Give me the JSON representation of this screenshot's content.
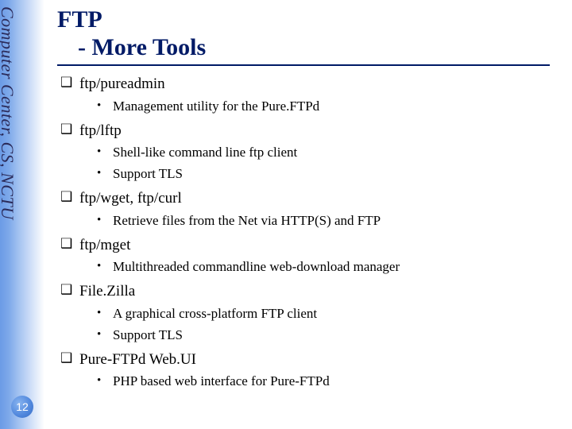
{
  "sidebar": {
    "label": "Computer Center, CS, NCTU"
  },
  "page": {
    "number": "12"
  },
  "title": {
    "line1": "FTP",
    "line2": "- More Tools"
  },
  "items": [
    {
      "label": "ftp/pureadmin",
      "sub": [
        "Management utility for the Pure.FTPd"
      ]
    },
    {
      "label": "ftp/lftp",
      "sub": [
        "Shell-like command line ftp client",
        "Support TLS"
      ]
    },
    {
      "label": "ftp/wget, ftp/curl",
      "sub": [
        "Retrieve files from the Net via HTTP(S) and FTP"
      ]
    },
    {
      "label": "ftp/mget",
      "sub": [
        "Multithreaded commandline web-download manager"
      ]
    },
    {
      "label": "File.Zilla",
      "sub": [
        "A graphical cross-platform FTP client",
        "Support TLS"
      ]
    },
    {
      "label": "Pure-FTPd Web.UI",
      "sub": [
        "PHP based web interface for Pure-FTPd"
      ]
    }
  ]
}
